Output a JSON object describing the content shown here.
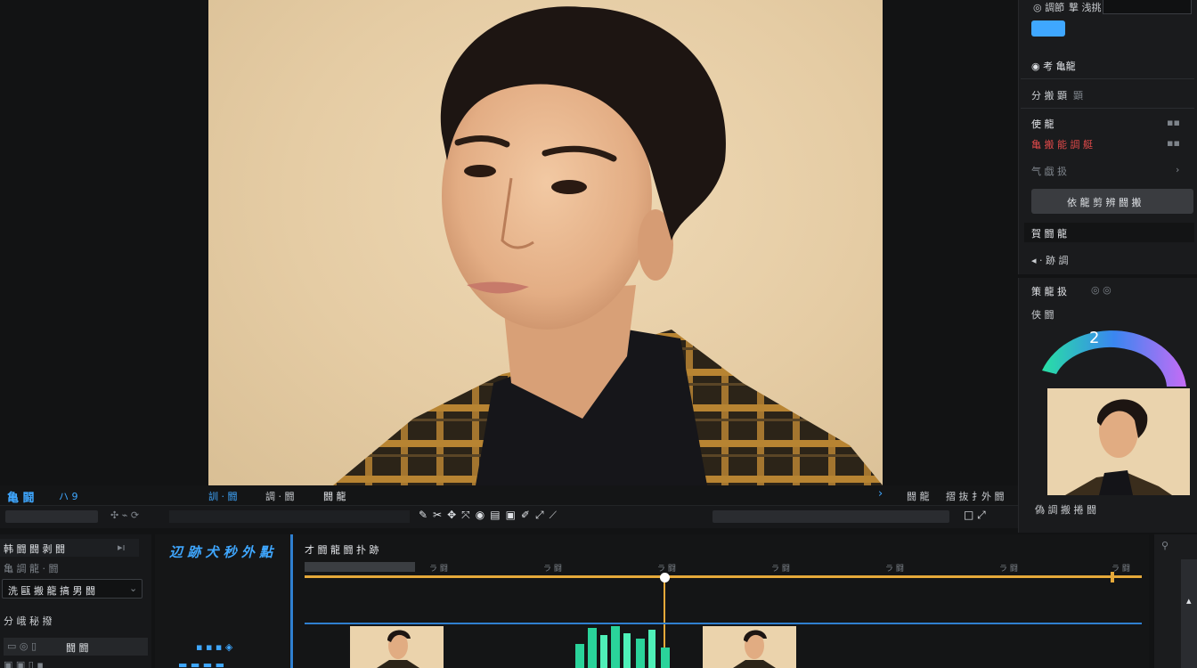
{
  "colors": {
    "accent": "#3fa7ff",
    "playhead": "#e5a93a",
    "panel": "#1a1b1d",
    "wheel_start": "#28e0a4",
    "wheel_end": "#c66cf5"
  },
  "right_panel": {
    "top_label_a": "◎ 調節",
    "top_label_b": "撃 浅挑",
    "blue_button": "",
    "row1": "◉ 考 亀龍",
    "row2_label": "分 搬 顕",
    "row2_value": "顕",
    "row3_label": "使 龍",
    "row4_label": "亀 搬 能 調 艇",
    "row5_label": "气 戯 扱",
    "wide_button": "依 龍 剪 辨 闘 搬",
    "header": "賀 闘 龍",
    "nav": "◂   ·   跡 調"
  },
  "right_panel2": {
    "title": "策 龍 扱",
    "title_icons": "◎ ◎",
    "subtitle": "侠 闘",
    "wheel_value": "2",
    "thumb_caption": "偽 調 搬 捲 闘"
  },
  "toolbar1": {
    "left_label": "亀 闘",
    "left_tag": "ハ 9",
    "mid1": "訓 · 闘",
    "mid2": "調 · 闘",
    "mid3": "闘 龍",
    "right1": "闘 龍",
    "right2": "摺 抜 扌外 闘"
  },
  "left_bottom": {
    "header": "韩 闘 闘 剥 闘",
    "sub": "亀 調 龍 · 闘",
    "select_value": "洗 甌 搬 龍 搞 男 闘",
    "row_a": "分    峨 秘 撥",
    "row_b": "闘 闘"
  },
  "track_names": {
    "title": "辺 跡 犬 秒 外 點"
  },
  "timeline": {
    "title": "才 闘 龍 闘 扑 跡",
    "ticks": [
      "ラ 闘",
      "ラ 闘",
      "ラ 闘",
      "ラ 闘",
      "ラ 闘",
      "ラ 闘",
      "ラ 闘"
    ],
    "playhead_fraction": 0.43
  }
}
